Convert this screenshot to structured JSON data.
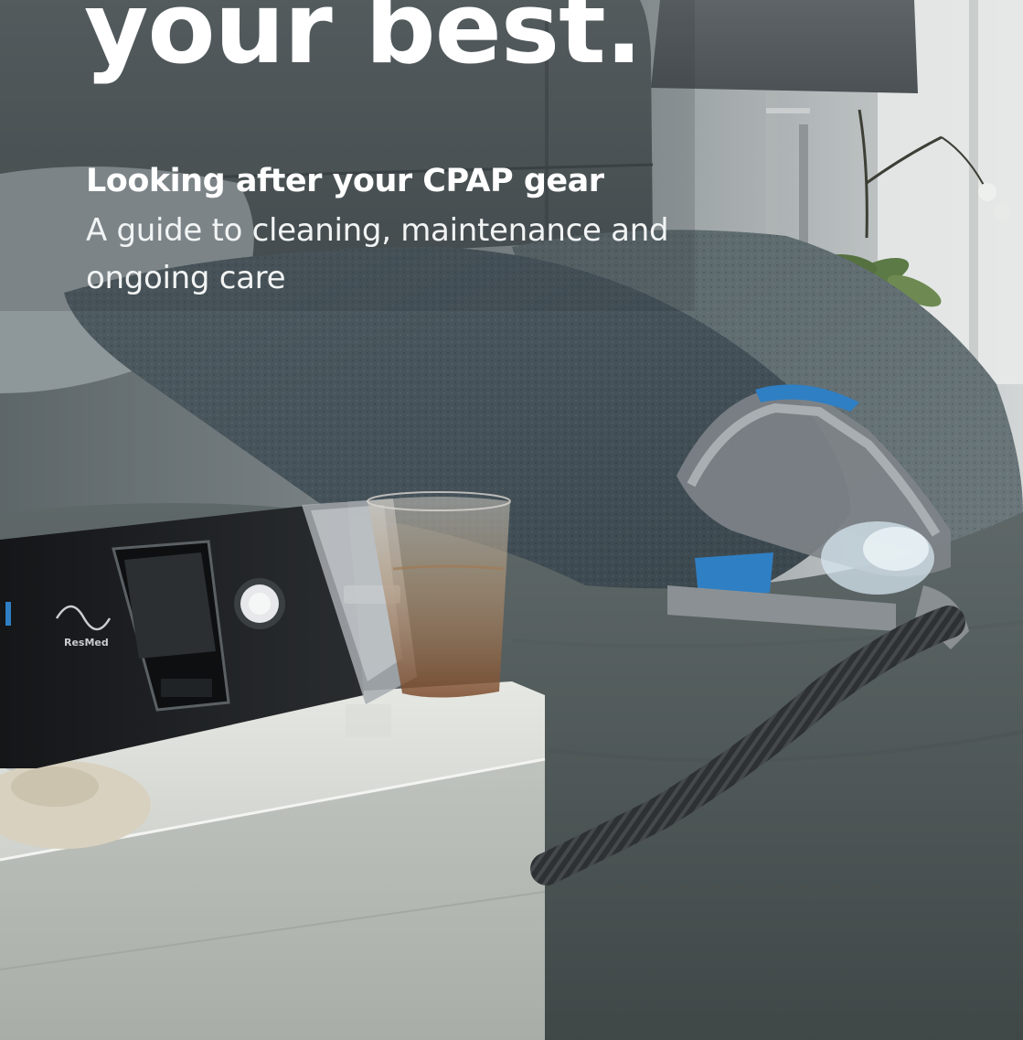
{
  "cover": {
    "headline": "your best.",
    "subtitle": "Looking after your CPAP gear",
    "description": "A guide to cleaning, maintenance and ongoing care"
  },
  "device": {
    "brand_label": "ResMed"
  },
  "colors": {
    "text": "#ffffff",
    "mask_accent": "#2f7fc4",
    "pillow": "#49565b",
    "bedside_table": "#d9dcd7"
  }
}
